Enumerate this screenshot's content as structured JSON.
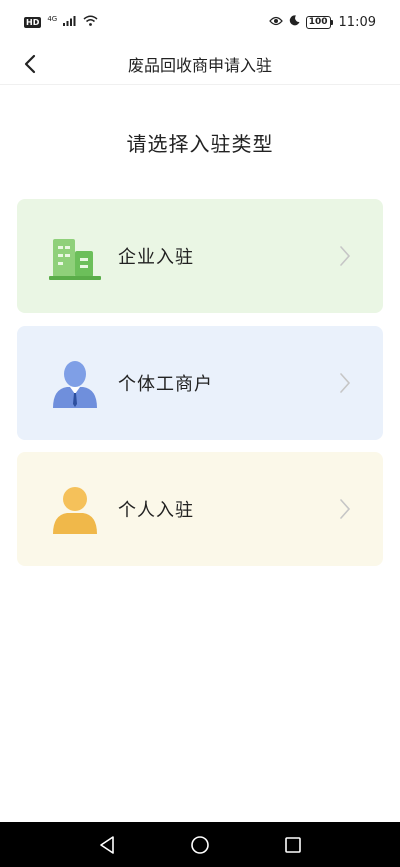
{
  "status_bar": {
    "hd": "HD",
    "network": "4G",
    "battery": "100",
    "time": "11:09"
  },
  "nav": {
    "title": "废品回收商申请入驻"
  },
  "heading": "请选择入驻类型",
  "options": [
    {
      "label": "企业入驻",
      "icon": "building-icon",
      "bg": "#eaf6e4",
      "icon_color": "#6cbf5a"
    },
    {
      "label": "个体工商户",
      "icon": "businessman-icon",
      "bg": "#eaf1fb",
      "icon_color": "#6f8fdc"
    },
    {
      "label": "个人入驻",
      "icon": "person-icon",
      "bg": "#fbf8e9",
      "icon_color": "#f0b84a"
    }
  ]
}
